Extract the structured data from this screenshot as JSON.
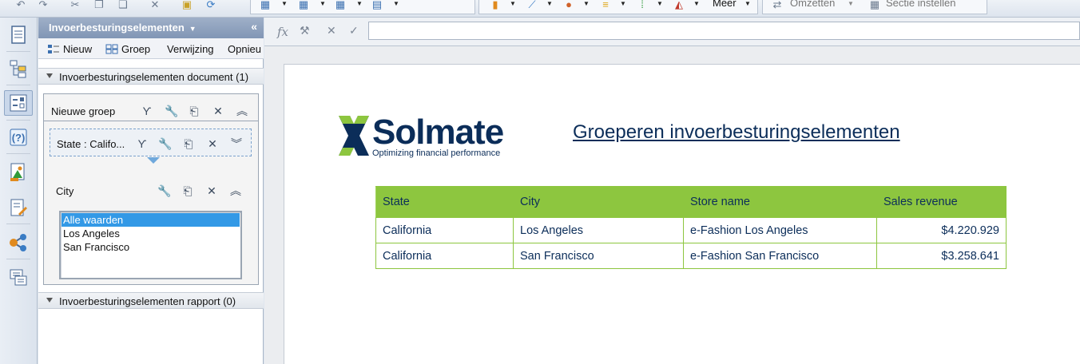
{
  "toolbar": {
    "more_label": "Meer",
    "convert_label": "Omzetten",
    "section_label": "Sectie instellen"
  },
  "panel": {
    "title": "Invoerbesturingselementen",
    "actions": [
      "Nieuw",
      "Groep",
      "Verwijzing",
      "Opnieu"
    ],
    "document_section": "Invoerbesturingselementen document (1)",
    "report_section": "Invoerbesturingselementen rapport (0)",
    "group": {
      "label": "Nieuwe groep",
      "state_control": "State : Califo...",
      "city_control": "City",
      "city_values": [
        "Alle waarden",
        "Los Angeles",
        "San Francisco"
      ],
      "selected_value": "Alle waarden"
    }
  },
  "formula": {
    "fx": "fx",
    "value": ""
  },
  "report": {
    "logo_name": "Solmate",
    "logo_tagline": "Optimizing financial performance",
    "title": "Groeperen invoerbesturingselementen",
    "table": {
      "columns": [
        "State",
        "City",
        "Store name",
        "Sales revenue"
      ],
      "rows": [
        [
          "California",
          "Los Angeles",
          "e-Fashion Los Angeles",
          "$4.220.929"
        ],
        [
          "California",
          "San Francisco",
          "e-Fashion San Francisco",
          "$3.258.641"
        ]
      ]
    },
    "colors": {
      "header_green": "#8dc63f",
      "text_navy": "#0b2d59"
    }
  }
}
